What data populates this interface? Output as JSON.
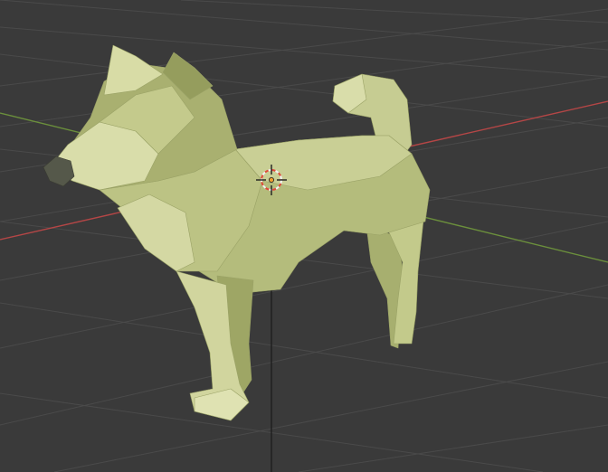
{
  "viewport": {
    "background_color": "#3a3a3a",
    "grid_color": "#4a4a4a",
    "x_axis_color": "#b44646",
    "y_axis_color": "#6b8f3c",
    "z_axis_color": "#1e1e1e"
  },
  "model": {
    "object": "low-poly dog",
    "base_color": "#b4bc7c",
    "highlight_color": "#d9ddaa",
    "shadow_color": "#8f985a",
    "nose_color": "#55584a"
  },
  "cursor": {
    "icon": "3d-cursor-icon",
    "ring_color_a": "#e04a3a",
    "ring_color_b": "#f2f2f2"
  }
}
